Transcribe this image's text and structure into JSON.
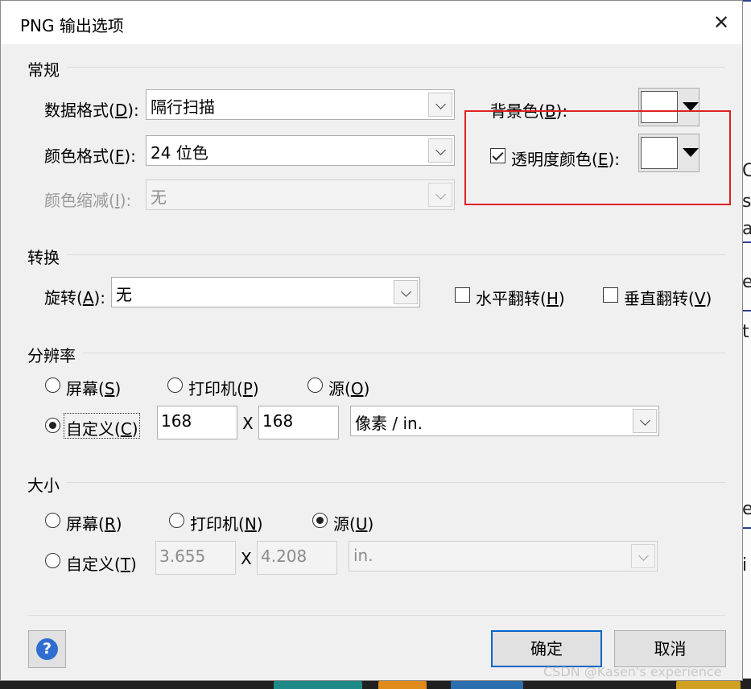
{
  "window": {
    "title": "PNG 输出选项",
    "close_icon": "close-icon"
  },
  "general": {
    "heading": "常规",
    "data_format": {
      "label": "数据格式(",
      "key": "D",
      "suffix": "):",
      "value": "隔行扫描"
    },
    "color_format": {
      "label": "颜色格式(",
      "key": "F",
      "suffix": "):",
      "value": "24 位色"
    },
    "color_reduction": {
      "label": "颜色缩减(",
      "key": "I",
      "suffix": "):",
      "value": "无",
      "disabled": true
    },
    "background_color": {
      "label": "背景色(",
      "key": "B",
      "suffix": "):",
      "color": "#ffffff"
    },
    "transparency_color": {
      "label": "透明度颜色(",
      "key": "E",
      "suffix": "):",
      "checked": true,
      "color": "#ffffff"
    }
  },
  "transform": {
    "heading": "转换",
    "rotation": {
      "label": "旋转(",
      "key": "A",
      "suffix": "):",
      "value": "无"
    },
    "flip_h": {
      "label": "水平翻转(",
      "key": "H",
      "suffix": ")",
      "checked": false
    },
    "flip_v": {
      "label": "垂直翻转(",
      "key": "V",
      "suffix": ")",
      "checked": false
    }
  },
  "resolution": {
    "heading": "分辨率",
    "options": [
      {
        "label": "屏幕(",
        "key": "S",
        "suffix": ")",
        "selected": false
      },
      {
        "label": "打印机(",
        "key": "P",
        "suffix": ")",
        "selected": false
      },
      {
        "label": "源(",
        "key": "O",
        "suffix": ")",
        "selected": false
      },
      {
        "label": "自定义(",
        "key": "C",
        "suffix": ")",
        "selected": true
      }
    ],
    "width": "168",
    "x_sep": "X",
    "height": "168",
    "unit": "像素 / in."
  },
  "size": {
    "heading": "大小",
    "options": [
      {
        "label": "屏幕(",
        "key": "R",
        "suffix": ")",
        "selected": false
      },
      {
        "label": "打印机(",
        "key": "N",
        "suffix": ")",
        "selected": false
      },
      {
        "label": "源(",
        "key": "U",
        "suffix": ")",
        "selected": true
      },
      {
        "label": "自定义(",
        "key": "T",
        "suffix": ")",
        "selected": false
      }
    ],
    "width": "3.655",
    "x_sep": "X",
    "height": "4.208",
    "unit": "in."
  },
  "buttons": {
    "ok": "确定",
    "cancel": "取消",
    "help_icon": "help-icon"
  },
  "accent": {
    "highlight": "#e02020",
    "default_button_border": "#0a64c8"
  },
  "watermark": "CSDN @Kasen's experience"
}
